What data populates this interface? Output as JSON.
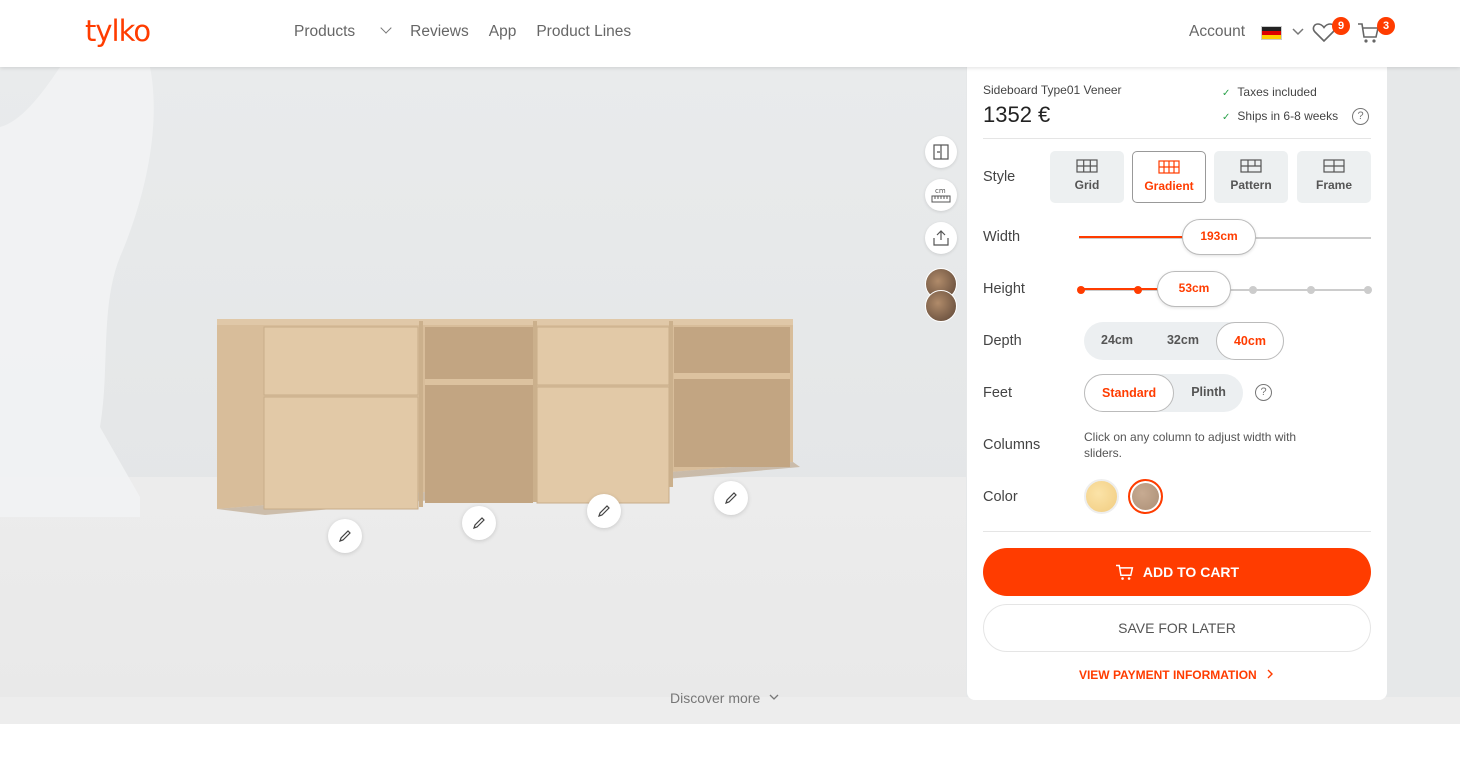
{
  "header": {
    "logo": "tylko",
    "nav": [
      {
        "label": "Products",
        "has_dropdown": true
      },
      {
        "label": "Reviews"
      },
      {
        "label": "App"
      },
      {
        "label": "Product Lines"
      }
    ],
    "account_label": "Account",
    "wishlist_count": "9",
    "cart_count": "3"
  },
  "viewer": {
    "discover_more": "Discover more",
    "tools": [
      "open-doors-icon",
      "dimensions-icon",
      "share-icon"
    ]
  },
  "panel": {
    "product_name": "Sideboard Type01 Veneer",
    "price": "1352 €",
    "perks": [
      "Taxes included",
      "Ships in 6-8 weeks"
    ],
    "style": {
      "label": "Style",
      "options": [
        {
          "label": "Grid",
          "active": false
        },
        {
          "label": "Gradient",
          "active": true
        },
        {
          "label": "Pattern",
          "active": false
        },
        {
          "label": "Frame",
          "active": false
        }
      ]
    },
    "width": {
      "label": "Width",
      "value": "193cm"
    },
    "height": {
      "label": "Height",
      "value": "53cm"
    },
    "depth": {
      "label": "Depth",
      "options": [
        "24cm",
        "32cm",
        "40cm"
      ],
      "selected": "40cm"
    },
    "feet": {
      "label": "Feet",
      "options": [
        "Standard",
        "Plinth"
      ],
      "selected": "Standard"
    },
    "columns": {
      "label": "Columns",
      "hint": "Click on any column to adjust width with sliders."
    },
    "color": {
      "label": "Color",
      "swatches": [
        "#f3d28d",
        "#b99b82"
      ],
      "selected_index": 1
    },
    "add_to_cart": "ADD TO CART",
    "save_for_later": "SAVE FOR LATER",
    "payment_info": "VIEW PAYMENT INFORMATION"
  },
  "colors": {
    "accent": "#ff3c00",
    "ok": "#2ca24b"
  }
}
